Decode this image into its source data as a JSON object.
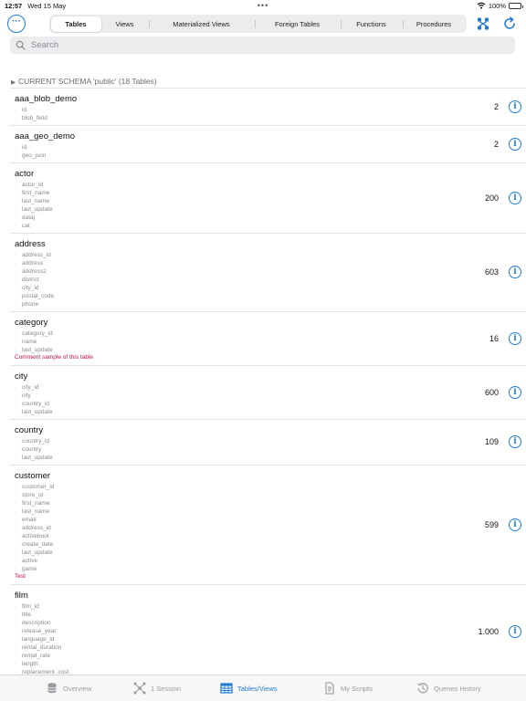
{
  "status": {
    "time": "12:57",
    "date": "Wed 15 May",
    "battery": "100%"
  },
  "toolbar": {
    "menu_icon": "ellipsis-circle-icon",
    "segments": [
      "Tables",
      "Views",
      "Materialized Views",
      "Foreign Tables",
      "Functions",
      "Procedures"
    ],
    "active_segment": "Tables",
    "right_icons": [
      "relations-icon",
      "refresh-icon"
    ],
    "accent": "#1e7bd6"
  },
  "search": {
    "placeholder": "Search"
  },
  "schema": {
    "header": "CURRENT SCHEMA 'public' (18 Tables)"
  },
  "tables": [
    {
      "name": "aaa_blob_demo",
      "columns": [
        "id",
        "blob_field"
      ],
      "count": "2",
      "comment": ""
    },
    {
      "name": "aaa_geo_demo",
      "columns": [
        "id",
        "geo_json"
      ],
      "count": "2",
      "comment": ""
    },
    {
      "name": "actor",
      "columns": [
        "actor_id",
        "first_name",
        "last_name",
        "last_update",
        "dataj",
        "cat"
      ],
      "count": "200",
      "comment": ""
    },
    {
      "name": "address",
      "columns": [
        "address_id",
        "address",
        "address2",
        "district",
        "city_id",
        "postal_code",
        "phone"
      ],
      "count": "603",
      "comment": ""
    },
    {
      "name": "category",
      "columns": [
        "category_id",
        "name",
        "last_update"
      ],
      "count": "16",
      "comment": "Comment sample of this table"
    },
    {
      "name": "city",
      "columns": [
        "city_id",
        "city",
        "country_id",
        "last_update"
      ],
      "count": "600",
      "comment": ""
    },
    {
      "name": "country",
      "columns": [
        "country_id",
        "country",
        "last_update"
      ],
      "count": "109",
      "comment": ""
    },
    {
      "name": "customer",
      "columns": [
        "customer_id",
        "store_id",
        "first_name",
        "last_name",
        "email",
        "address_id",
        "activebool",
        "create_date",
        "last_update",
        "active",
        "game"
      ],
      "count": "599",
      "comment": "Test"
    },
    {
      "name": "film",
      "columns": [
        "film_id",
        "title",
        "description",
        "release_year",
        "language_id",
        "rental_duration",
        "rental_rate",
        "length",
        "replacement_cost"
      ],
      "count": "1.000",
      "comment": ""
    }
  ],
  "tabbar": {
    "items": [
      {
        "label": "Overview",
        "icon": "database-icon"
      },
      {
        "label": "1 Session",
        "icon": "network-icon"
      },
      {
        "label": "Tables/Views",
        "icon": "table-icon"
      },
      {
        "label": "My Scripts",
        "icon": "document-icon"
      },
      {
        "label": "Queries History",
        "icon": "history-icon"
      }
    ],
    "active": "Tables/Views"
  }
}
